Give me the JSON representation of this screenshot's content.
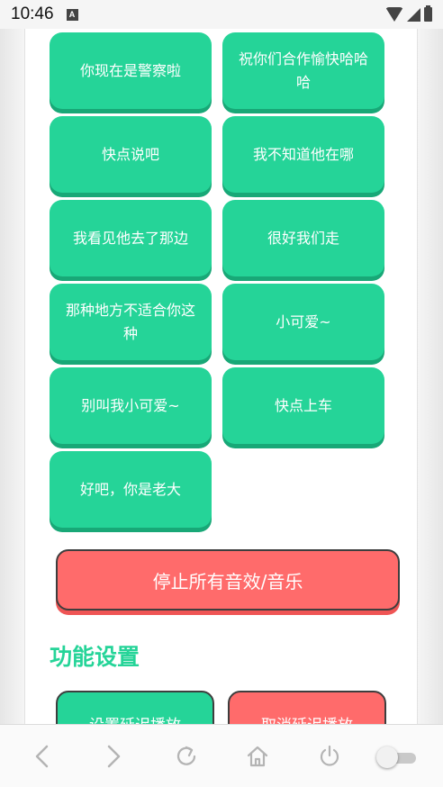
{
  "status_bar": {
    "time": "10:46",
    "notification_icon_label": "A",
    "icons": [
      "wifi-icon",
      "signal-icon",
      "battery-icon"
    ]
  },
  "sound_buttons": [
    {
      "label": "你现在是警察啦"
    },
    {
      "label": "祝你们合作愉快哈哈哈"
    },
    {
      "label": "快点说吧"
    },
    {
      "label": "我不知道他在哪"
    },
    {
      "label": "我看见他去了那边"
    },
    {
      "label": "很好我们走"
    },
    {
      "label": "那种地方不适合你这种"
    },
    {
      "label": "小可爱~"
    },
    {
      "label": "别叫我小可爱~"
    },
    {
      "label": "快点上车"
    },
    {
      "label": "好吧，你是老大"
    }
  ],
  "stop_all": {
    "label": "停止所有音效/音乐"
  },
  "settings": {
    "title": "功能设置",
    "set_delay_label": "设置延迟播放",
    "cancel_delay_label": "取消延迟播放"
  },
  "browser_nav": {
    "icons": [
      "back-icon",
      "forward-icon",
      "refresh-icon",
      "home-icon",
      "power-icon",
      "toggle-switch"
    ]
  },
  "colors": {
    "accent_green": "#25d498",
    "green_shadow": "#18a877",
    "accent_red": "#ff6b6b",
    "icon_gray": "#b4b4b4"
  }
}
